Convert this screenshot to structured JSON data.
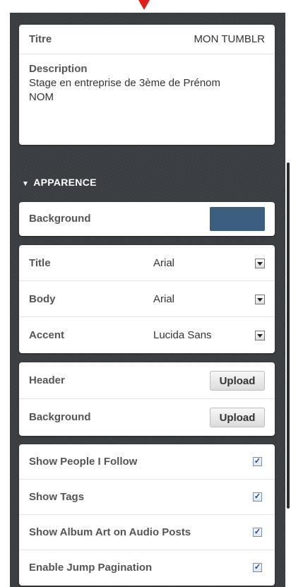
{
  "info": {
    "title_label": "Titre",
    "title_value": "MON TUMBLR",
    "description_label": "Description",
    "description_line1": "Stage en entreprise de 3ème de Prénom",
    "description_line2": "NOM"
  },
  "appearance": {
    "section_title": "APPARENCE",
    "background_label": "Background",
    "background_color": "#3d5f7f"
  },
  "fonts": [
    {
      "label": "Title",
      "value": "Arial"
    },
    {
      "label": "Body",
      "value": "Arial"
    },
    {
      "label": "Accent",
      "value": "Lucida Sans"
    }
  ],
  "uploads": [
    {
      "label": "Header",
      "button": "Upload"
    },
    {
      "label": "Background",
      "button": "Upload"
    }
  ],
  "options": [
    {
      "label": "Show People I Follow",
      "checked": true
    },
    {
      "label": "Show Tags",
      "checked": true
    },
    {
      "label": "Show Album Art on Audio Posts",
      "checked": true
    },
    {
      "label": "Enable Jump Pagination",
      "checked": true
    }
  ],
  "icons": {
    "pointer": "arrow-down-icon",
    "section_toggle": "triangle-down-icon",
    "select": "chevron-down-icon",
    "checkbox": "checkmark-icon"
  },
  "colors": {
    "panel": "#3a3d42",
    "pointer": "#e01e1e"
  }
}
